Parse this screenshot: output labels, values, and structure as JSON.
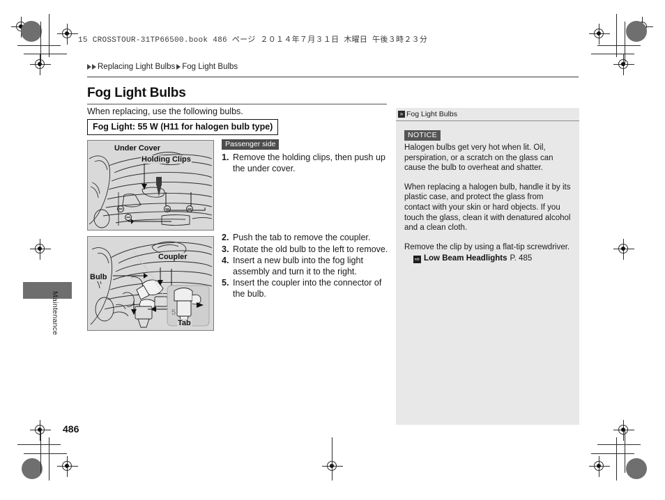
{
  "print_header": "15 CROSSTOUR-31TP66500.book  486 ページ  ２０１４年７月３１日  木曜日  午後３時２３分",
  "breadcrumb": {
    "parent": "Replacing Light Bulbs",
    "current": "Fog Light Bulbs"
  },
  "page": {
    "title": "Fog Light Bulbs",
    "intro": "When replacing, use the following bulbs.",
    "spec": "Fog Light: 55 W (H11 for halogen bulb type)",
    "folio": "486",
    "margin_tab_label": "Maintenance"
  },
  "figures": [
    {
      "name": "under-cover",
      "labels": {
        "under_cover": "Under Cover",
        "holding_clips": "Holding Clips"
      }
    },
    {
      "name": "coupler-bulb",
      "labels": {
        "bulb": "Bulb",
        "coupler": "Coupler",
        "tab": "Tab"
      }
    }
  ],
  "steps_group_1": {
    "badge": "Passenger side",
    "items": [
      {
        "num": "1.",
        "text": "Remove the holding clips, then push up the under cover."
      }
    ]
  },
  "steps_group_2": {
    "items": [
      {
        "num": "2.",
        "text": "Push the tab to remove the coupler."
      },
      {
        "num": "3.",
        "text": "Rotate the old bulb to the left to remove."
      },
      {
        "num": "4.",
        "text": "Insert a new bulb into the fog light assembly and turn it to the right."
      },
      {
        "num": "5.",
        "text": "Insert the coupler into the connector of the bulb."
      }
    ]
  },
  "side_panel": {
    "header_icon": "chevron-double-right-icon",
    "header_title": "Fog Light Bulbs",
    "notice_badge": "NOTICE",
    "paragraphs": [
      "Halogen bulbs get very hot when lit. Oil, perspiration, or a scratch on the glass can cause the bulb to overheat and shatter.",
      "When replacing a halogen bulb, handle it by its plastic case, and protect the glass from contact with your skin or hard objects. If you touch the glass, clean it with denatured alcohol and a clean cloth.",
      "Remove the clip by using a flat-tip screwdriver."
    ],
    "xref": {
      "icon": "jump-arrow-icon",
      "title": "Low Beam Headlights",
      "page": "P. 485"
    }
  },
  "colors": {
    "figure_bg": "#d9d9d9",
    "panel_bg": "#e8e8e8",
    "badge_bg": "#4c4c4c",
    "tab_gray": "#6e6e6e"
  }
}
